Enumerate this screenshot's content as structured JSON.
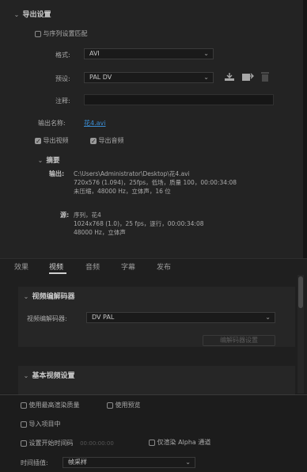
{
  "export_settings": {
    "section_title": "导出设置",
    "match_sequence_label": "与序列设置匹配",
    "format_label": "格式:",
    "format_value": "AVI",
    "preset_label": "预设:",
    "preset_value": "PAL DV",
    "comment_label": "注释:",
    "comment_value": "",
    "output_name_label": "输出名称:",
    "output_name_value": "花4.avi",
    "export_video_label": "导出视频",
    "export_audio_label": "导出音频",
    "summary_title": "摘要",
    "output_label": "输出:",
    "output_lines": [
      "C:\\Users\\Administrator\\Desktop\\花4.avi",
      "720x576 (1.094)，25fps，低场，质量 100，00:00:34:08",
      "未压缩，48000 Hz，立体声，16 位"
    ],
    "source_label": "源:",
    "source_lines": [
      "序列，花4",
      "1024x768 (1.0)，25 fps，逐行，00:00:34:08",
      "48000 Hz，立体声"
    ]
  },
  "tabs": [
    "效果",
    "视频",
    "音频",
    "字幕",
    "发布"
  ],
  "active_tab": "视频",
  "video_codec": {
    "section_title": "视频编解码器",
    "codec_label": "视频编解码器:",
    "codec_value": "DV PAL",
    "codec_settings_button": "编解码器设置"
  },
  "basic_video": {
    "section_title": "基本视频设置"
  },
  "bottom": {
    "max_render_quality_label": "使用最高渲染质量",
    "use_previews_label": "使用预览",
    "import_project_label": "导入项目中",
    "set_start_timecode_label": "设置开始时间码",
    "start_timecode_value": "00:00:00:00",
    "render_alpha_label": "仅渲染 Alpha 通道",
    "time_interpolation_label": "时间插值:",
    "time_interpolation_value": "帧采样"
  },
  "colors": {
    "link": "#3b8fd6",
    "panel_bg": "#232323",
    "dark_bg": "#1c1c1c"
  }
}
